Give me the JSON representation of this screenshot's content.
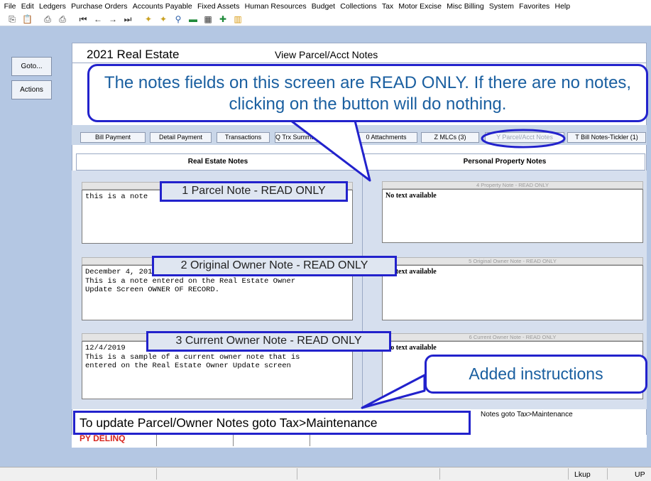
{
  "menubar": [
    "File",
    "Edit",
    "Ledgers",
    "Purchase Orders",
    "Accounts Payable",
    "Fixed Assets",
    "Human Resources",
    "Budget",
    "Collections",
    "Tax",
    "Motor Excise",
    "Misc Billing",
    "System",
    "Favorites",
    "Help"
  ],
  "toolbar_icons": [
    "copy-icon",
    "paste-icon",
    "print-icon",
    "print-preview-icon",
    "first-record-icon",
    "previous-record-icon",
    "next-record-icon",
    "last-record-icon",
    "lookup-icon",
    "lookup-alt-icon",
    "search-icon",
    "mail-icon",
    "options-icon",
    "exit-icon",
    "report-icon"
  ],
  "left_buttons": {
    "goto": "Goto...",
    "actions": "Actions"
  },
  "header": {
    "app_title": "2021 Real Estate",
    "screen_title": "View Parcel/Acct Notes"
  },
  "tabs": [
    "Bill Payment",
    "Detail Payment",
    "Transactions",
    "Q Trx Summary",
    "0 Attachments",
    "Z MLCs (3)",
    "Y Parcel/Acct Notes",
    "T Bill Notes-Tickler (1)"
  ],
  "columns": {
    "left": "Real Estate Notes",
    "right": "Personal Property Notes"
  },
  "real_estate_notes": [
    {
      "text": "this is a note"
    },
    {
      "text": "December 4, 2019\nThis is a note entered on the Real Estate Owner\nUpdate Screen OWNER OF RECORD."
    },
    {
      "text": "12/4/2019\nThis is a sample of a current owner note that is\nentered on the Real Estate Owner Update screen"
    }
  ],
  "personal_property_notes": [
    {
      "label": "4 Property Note - READ ONLY",
      "text": "No text available"
    },
    {
      "label": "5 Original Owner Note - READ ONLY",
      "text": "No text available"
    },
    {
      "label": "6 Current Owner Note - READ ONLY",
      "text": "No text available"
    }
  ],
  "callouts": {
    "main": "The notes fields on this screen are READ ONLY. If there are no notes, clicking on the button will do nothing.",
    "added": "Added instructions"
  },
  "note_labels": [
    "1 Parcel Note - READ ONLY",
    "2 Original Owner Note - READ ONLY",
    "3 Current Owner Note - READ ONLY"
  ],
  "instruction": "To update Parcel/Owner Notes goto Tax>Maintenance",
  "instruction_partial": "Notes goto Tax>Maintenance",
  "py_delinq": "PY DELINQ",
  "status": {
    "lkup": "Lkup",
    "up": "UP"
  },
  "colors": {
    "callout_border": "#2222cc",
    "callout_text": "#1a5fa0",
    "background": "#b4c7e3",
    "delinq": "#d8261f"
  }
}
